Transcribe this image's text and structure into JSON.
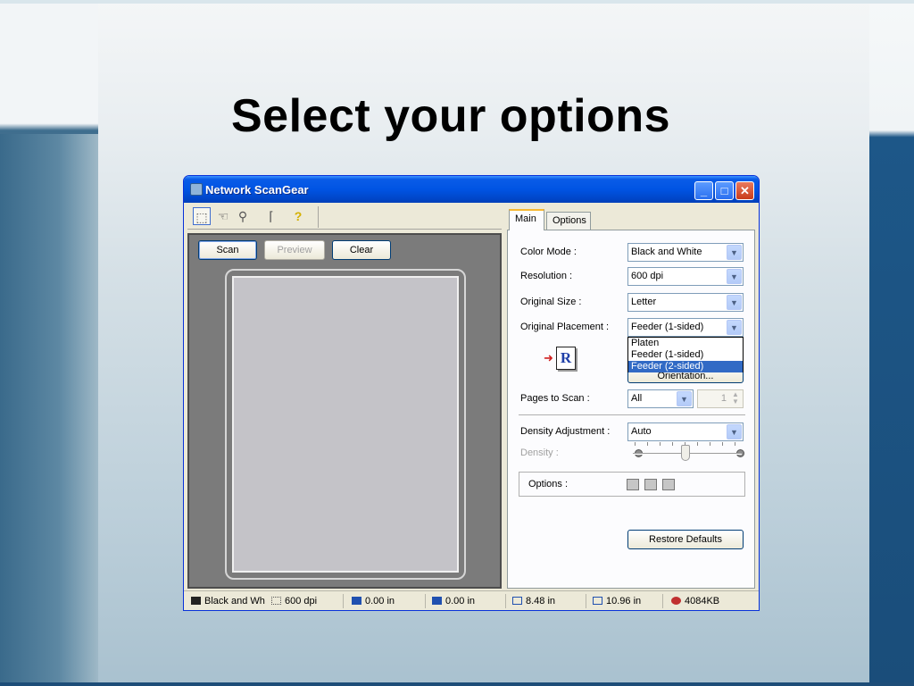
{
  "slide": {
    "title": "Select your options"
  },
  "window": {
    "title": "Network ScanGear",
    "controls": {
      "minimize": "_",
      "maximize": "□",
      "close": "✕"
    }
  },
  "toolbar": {
    "tools": [
      "selection-icon",
      "hand-icon",
      "zoom-icon",
      "crop-icon",
      "help-icon"
    ],
    "help_glyph": "?"
  },
  "preview_panel": {
    "scan_label": "Scan",
    "preview_label": "Preview",
    "clear_label": "Clear"
  },
  "tabs": {
    "main": "Main",
    "options": "Options",
    "active": "Main"
  },
  "settings": {
    "color_mode": {
      "label": "Color Mode :",
      "value": "Black and White"
    },
    "resolution": {
      "label": "Resolution :",
      "value": "600 dpi"
    },
    "original_size": {
      "label": "Original Size :",
      "value": "Letter"
    },
    "original_placement": {
      "label": "Original Placement :",
      "value": "Feeder (1-sided)",
      "options": [
        "Platen",
        "Feeder (1-sided)",
        "Feeder (2-sided)"
      ],
      "highlighted": "Feeder (2-sided)"
    },
    "orientation_button": "Orientation...",
    "orientation_glyph": "R",
    "pages_to_scan": {
      "label": "Pages to Scan :",
      "value": "All",
      "count": "1"
    },
    "density_adjustment": {
      "label": "Density Adjustment :",
      "value": "Auto"
    },
    "density": {
      "label": "Density :"
    },
    "options_label": "Options :",
    "restore_defaults": "Restore Defaults"
  },
  "statusbar": {
    "color_mode": "Black and Wh",
    "resolution": "600 dpi",
    "left": "0.00 in",
    "top": "0.00 in",
    "width": "8.48 in",
    "height": "10.96 in",
    "size": "4084KB"
  },
  "colors": {
    "titlebar": "#0054e3",
    "selection": "#316ac5",
    "close_button": "#c93b1a"
  }
}
